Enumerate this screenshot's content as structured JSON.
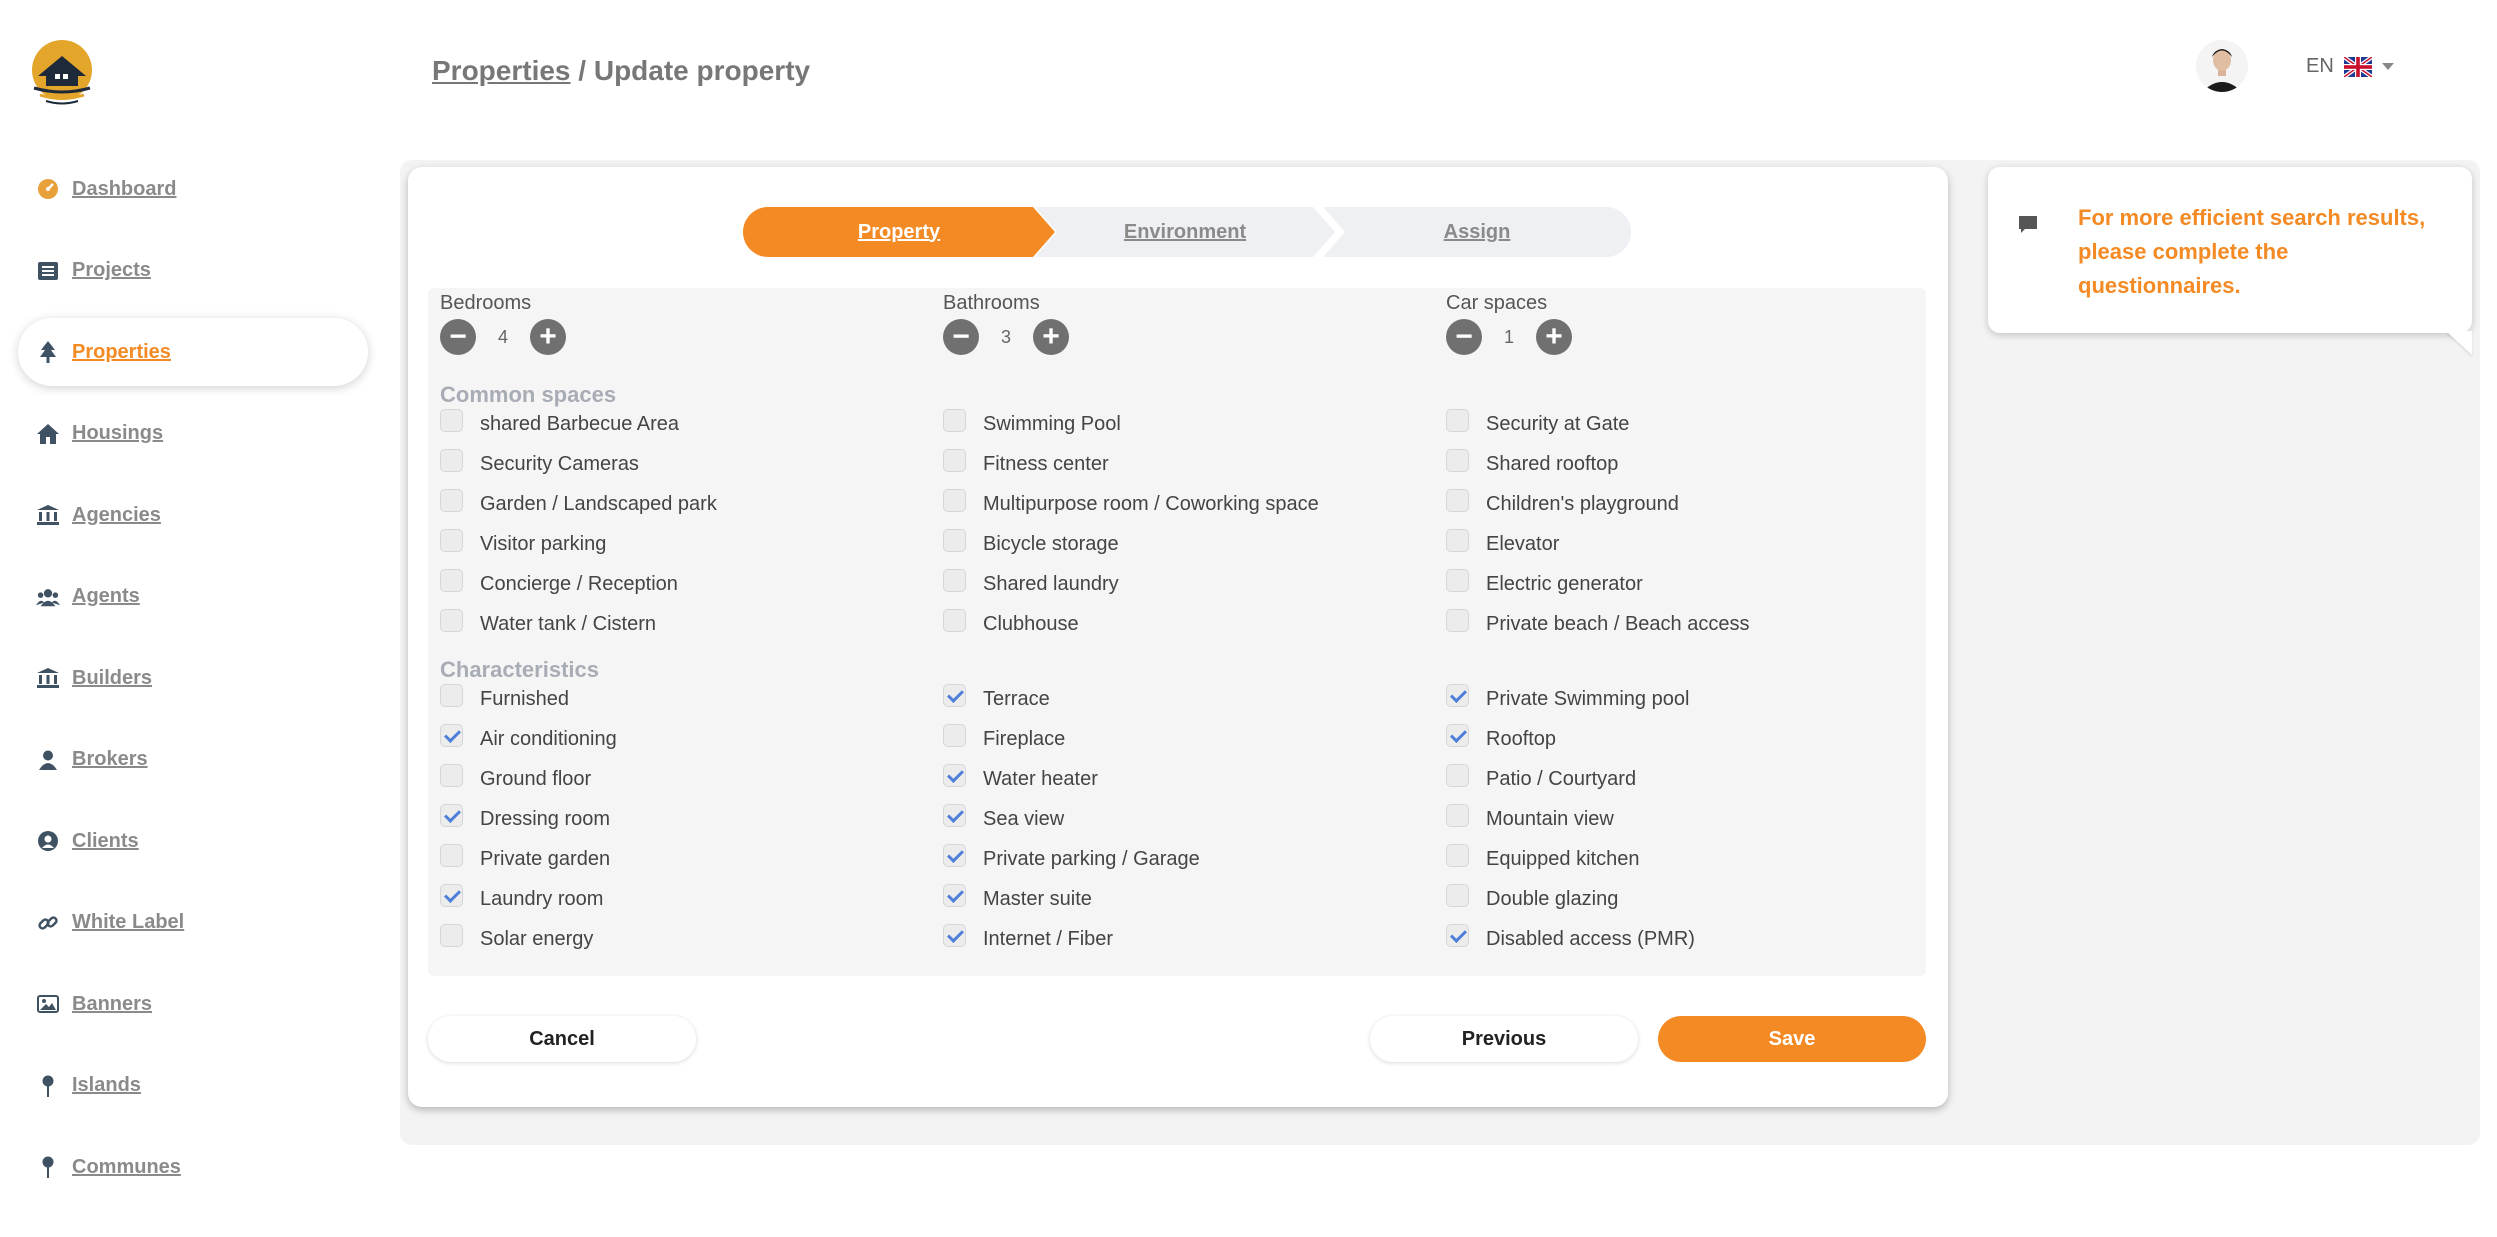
{
  "brand": {
    "accent": "#f38a24",
    "muted": "#8a8a8a"
  },
  "sidebar": {
    "items": [
      {
        "label": "Dashboard",
        "icon": "gauge-icon",
        "active": false
      },
      {
        "label": "Projects",
        "icon": "list-icon",
        "active": false
      },
      {
        "label": "Properties",
        "icon": "tree-icon",
        "active": true
      },
      {
        "label": "Housings",
        "icon": "house-icon",
        "active": false
      },
      {
        "label": "Agencies",
        "icon": "bank-icon",
        "active": false
      },
      {
        "label": "Agents",
        "icon": "users-icon",
        "active": false
      },
      {
        "label": "Builders",
        "icon": "bank-icon",
        "active": false
      },
      {
        "label": "Brokers",
        "icon": "user-icon",
        "active": false
      },
      {
        "label": "Clients",
        "icon": "user-circle-icon",
        "active": false
      },
      {
        "label": "White Label",
        "icon": "link-icon",
        "active": false
      },
      {
        "label": "Banners",
        "icon": "image-icon",
        "active": false
      },
      {
        "label": "Islands",
        "icon": "pin-icon",
        "active": false
      },
      {
        "label": "Communes",
        "icon": "pin-icon",
        "active": false
      }
    ]
  },
  "header": {
    "breadcrumb_link": "Properties",
    "breadcrumb_sep": "/",
    "breadcrumb_current": "Update property",
    "lang": "EN"
  },
  "steps": [
    "Property",
    "Environment",
    "Assign"
  ],
  "counters": [
    {
      "label": "Bedrooms",
      "value": "4"
    },
    {
      "label": "Bathrooms",
      "value": "3"
    },
    {
      "label": "Car spaces",
      "value": "1"
    }
  ],
  "sections": {
    "common_title": "Common spaces",
    "common": [
      [
        {
          "label": "shared Barbecue Area",
          "checked": false
        },
        {
          "label": "Security Cameras",
          "checked": false
        },
        {
          "label": "Garden / Landscaped park",
          "checked": false
        },
        {
          "label": "Visitor parking",
          "checked": false
        },
        {
          "label": "Concierge / Reception",
          "checked": false
        },
        {
          "label": "Water tank / Cistern",
          "checked": false
        }
      ],
      [
        {
          "label": "Swimming Pool",
          "checked": false
        },
        {
          "label": "Fitness center",
          "checked": false
        },
        {
          "label": "Multipurpose room / Coworking space",
          "checked": false
        },
        {
          "label": "Bicycle storage",
          "checked": false
        },
        {
          "label": "Shared laundry",
          "checked": false
        },
        {
          "label": "Clubhouse",
          "checked": false
        }
      ],
      [
        {
          "label": "Security at Gate",
          "checked": false
        },
        {
          "label": "Shared rooftop",
          "checked": false
        },
        {
          "label": "Children's playground",
          "checked": false
        },
        {
          "label": "Elevator",
          "checked": false
        },
        {
          "label": "Electric generator",
          "checked": false
        },
        {
          "label": "Private beach / Beach access",
          "checked": false
        }
      ]
    ],
    "char_title": "Characteristics",
    "characteristics": [
      [
        {
          "label": "Furnished",
          "checked": false
        },
        {
          "label": "Air conditioning",
          "checked": true
        },
        {
          "label": "Ground floor",
          "checked": false
        },
        {
          "label": "Dressing room",
          "checked": true
        },
        {
          "label": "Private garden",
          "checked": false
        },
        {
          "label": "Laundry room",
          "checked": true
        },
        {
          "label": "Solar energy",
          "checked": false
        }
      ],
      [
        {
          "label": "Terrace",
          "checked": true
        },
        {
          "label": "Fireplace",
          "checked": false
        },
        {
          "label": "Water heater",
          "checked": true
        },
        {
          "label": "Sea view",
          "checked": true
        },
        {
          "label": "Private parking / Garage",
          "checked": true
        },
        {
          "label": "Master suite",
          "checked": true
        },
        {
          "label": "Internet / Fiber",
          "checked": true
        }
      ],
      [
        {
          "label": "Private Swimming pool",
          "checked": true
        },
        {
          "label": "Rooftop",
          "checked": true
        },
        {
          "label": "Patio / Courtyard",
          "checked": false
        },
        {
          "label": "Mountain view",
          "checked": false
        },
        {
          "label": "Equipped kitchen",
          "checked": false
        },
        {
          "label": "Double glazing",
          "checked": false
        },
        {
          "label": "Disabled access (PMR)",
          "checked": true
        }
      ]
    ]
  },
  "buttons": {
    "cancel": "Cancel",
    "previous": "Previous",
    "save": "Save"
  },
  "tip": {
    "text": "For more efficient search results, please complete the questionnaires."
  }
}
